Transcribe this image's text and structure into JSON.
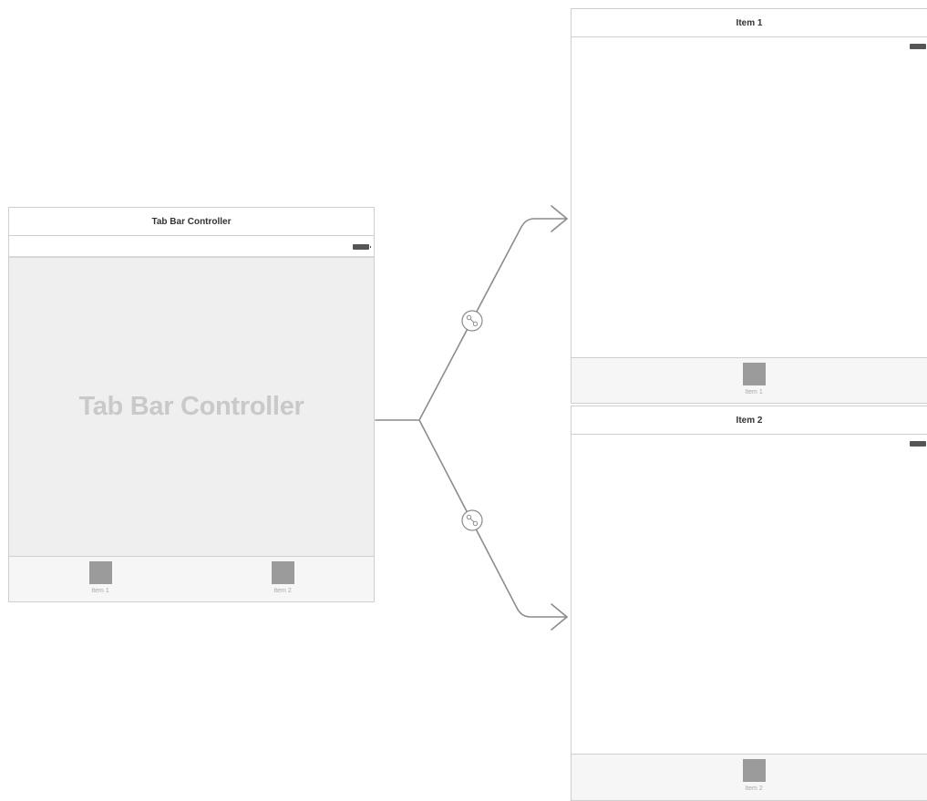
{
  "tab_bar_controller": {
    "title": "Tab Bar Controller",
    "content_label": "Tab Bar Controller",
    "tabs": [
      {
        "label": "Item 1",
        "icon": "tab-placeholder-icon"
      },
      {
        "label": "Item 2",
        "icon": "tab-placeholder-icon"
      }
    ]
  },
  "item1_scene": {
    "title": "Item 1",
    "tab": {
      "label": "Item 1",
      "icon": "tab-placeholder-icon"
    }
  },
  "item2_scene": {
    "title": "Item 2",
    "tab": {
      "label": "Item 2",
      "icon": "tab-placeholder-icon"
    }
  },
  "colors": {
    "canvas": "#ffffff",
    "scene_border": "#cfcfcf",
    "controller_background": "#efefef",
    "tab_bar_background": "#f6f6f6",
    "tab_icon": "#9b9b9b",
    "segue_line": "#8c8c8c"
  }
}
